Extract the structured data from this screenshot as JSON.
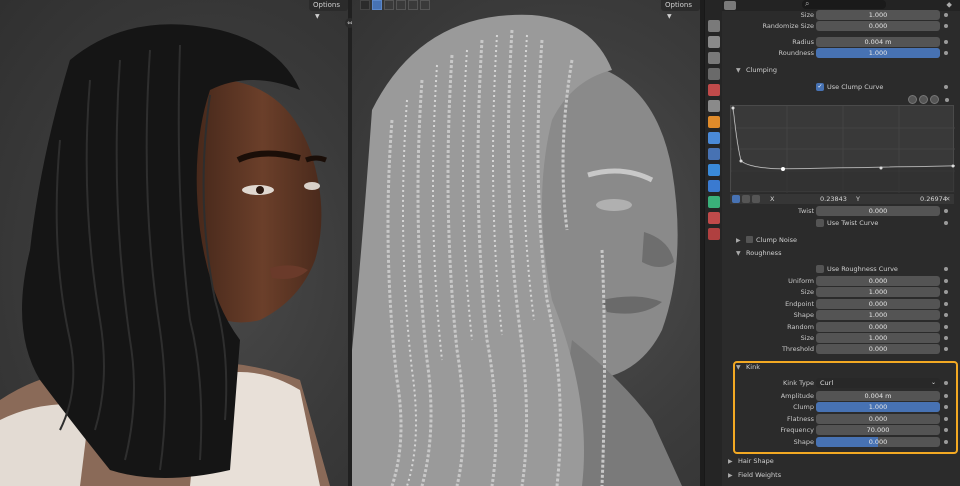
{
  "viewport_left": {
    "options_label": "Options"
  },
  "viewport_right": {
    "options_label": "Options"
  },
  "divider_icon": "swap-icon",
  "properties": {
    "accent": "#4772b3",
    "highlight_color": "#f3a923",
    "top_rows": [
      {
        "label": "Size",
        "value": "1.000"
      },
      {
        "label": "Randomize Size",
        "value": "0.000"
      },
      {
        "label": "Radius",
        "value": "0.004 m"
      },
      {
        "label": "Roundness",
        "value": "1.000",
        "fill": 1.0
      }
    ],
    "clumping": {
      "title": "Clumping",
      "use_clump_curve": "Use Clump Curve",
      "curve_x_label": "X",
      "curve_x_value": "0.23843",
      "curve_y_label": "Y",
      "curve_y_value": "0.26974",
      "twist_label": "Twist",
      "twist_value": "0.000",
      "use_twist_curve": "Use Twist Curve",
      "clump_noise": "Clump Noise"
    },
    "roughness": {
      "title": "Roughness",
      "use_roughness_curve": "Use Roughness Curve",
      "rows": [
        {
          "label": "Uniform",
          "value": "0.000"
        },
        {
          "label": "Size",
          "value": "1.000"
        },
        {
          "label": "Endpoint",
          "value": "0.000"
        },
        {
          "label": "Shape",
          "value": "1.000"
        },
        {
          "label": "Random",
          "value": "0.000"
        },
        {
          "label": "Size",
          "value": "1.000"
        },
        {
          "label": "Threshold",
          "value": "0.000"
        }
      ]
    },
    "kink": {
      "title": "Kink",
      "type_label": "Kink Type",
      "type_value": "Curl",
      "rows": [
        {
          "label": "Amplitude",
          "value": "0.004 m",
          "fill": 0
        },
        {
          "label": "Clump",
          "value": "1.000",
          "fill": 1.0
        },
        {
          "label": "Flatness",
          "value": "0.000",
          "fill": 0
        },
        {
          "label": "Frequency",
          "value": "70.000",
          "fill": 0
        },
        {
          "label": "Shape",
          "value": "0.000",
          "fill": 0.5
        }
      ]
    },
    "hair_shape": "Hair Shape",
    "field_weights": "Field Weights"
  }
}
